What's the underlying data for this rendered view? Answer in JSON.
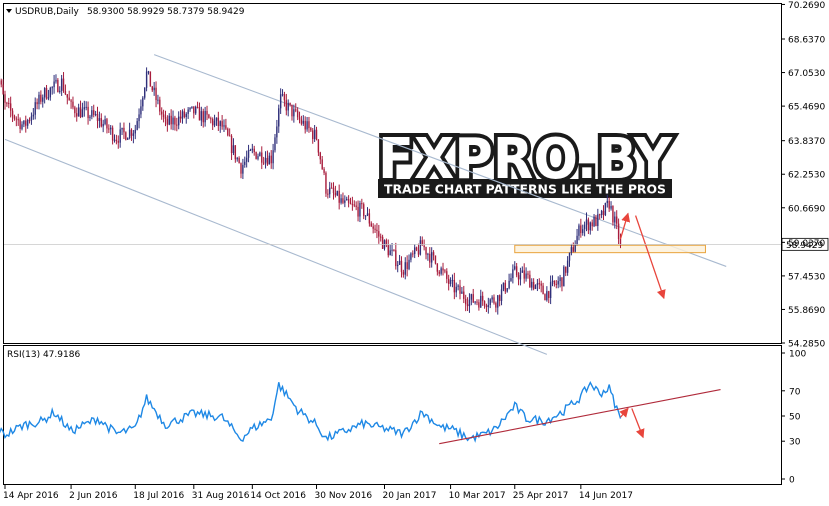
{
  "header": {
    "title": "USDRUB,Daily",
    "ohlc": "58.9300 58.9929 58.7379 58.9429"
  },
  "watermark": {
    "brand": "FXPRO.BY",
    "tagline": "TRADE CHART PATTERNS LIKE THE PROS"
  },
  "colors": {
    "bull": "#2f2f7a",
    "bear": "#a81c3c",
    "rsi": "#1e88e5",
    "channel": "#a8b9cf",
    "arrow": "#e8453c",
    "support_zone_stroke": "#e8a33c",
    "support_zone_fill": "#fdf0d8",
    "rsi_trendline": "#b02a3a"
  },
  "chart_data": [
    {
      "type": "candlestick",
      "symbol": "USDRUB",
      "timeframe": "Daily",
      "current_price_label": "58.9429",
      "current_price": 58.9429,
      "ylim": [
        54.285,
        70.29
      ],
      "y_tick_labels": [
        "70.2690",
        "68.6370",
        "67.0530",
        "65.4690",
        "63.8370",
        "62.2530",
        "60.6690",
        "59.0370",
        "57.4530",
        "55.8690",
        "54.2850"
      ],
      "x_tick_labels": [
        "14 Apr 2016",
        "2 Jun 2016",
        "18 Jul 2016",
        "31 Aug 2016",
        "14 Oct 2016",
        "30 Nov 2016",
        "20 Jan 2017",
        "10 Mar 2017",
        "25 Apr 2017",
        "14 Jun 2017"
      ],
      "x_tick_dates": [
        "2016-04-14",
        "2016-06-02",
        "2016-07-18",
        "2016-08-31",
        "2016-10-14",
        "2016-11-30",
        "2017-01-20",
        "2017-03-10",
        "2017-04-25",
        "2017-06-14"
      ],
      "approx_closes": [
        {
          "date": "2016-04-04",
          "close": 67.8
        },
        {
          "date": "2016-04-14",
          "close": 65.5
        },
        {
          "date": "2016-04-28",
          "close": 64.5
        },
        {
          "date": "2016-05-12",
          "close": 66.0
        },
        {
          "date": "2016-05-26",
          "close": 66.6
        },
        {
          "date": "2016-06-02",
          "close": 65.4
        },
        {
          "date": "2016-06-20",
          "close": 64.9
        },
        {
          "date": "2016-07-04",
          "close": 64.0
        },
        {
          "date": "2016-07-18",
          "close": 64.4
        },
        {
          "date": "2016-07-27",
          "close": 67.0
        },
        {
          "date": "2016-08-10",
          "close": 64.6
        },
        {
          "date": "2016-08-31",
          "close": 65.2
        },
        {
          "date": "2016-09-21",
          "close": 64.5
        },
        {
          "date": "2016-10-05",
          "close": 62.6
        },
        {
          "date": "2016-10-14",
          "close": 63.3
        },
        {
          "date": "2016-10-28",
          "close": 63.0
        },
        {
          "date": "2016-11-04",
          "close": 65.8
        },
        {
          "date": "2016-11-15",
          "close": 64.9
        },
        {
          "date": "2016-11-30",
          "close": 64.0
        },
        {
          "date": "2016-12-07",
          "close": 61.6
        },
        {
          "date": "2016-12-20",
          "close": 60.8
        },
        {
          "date": "2017-01-03",
          "close": 60.5
        },
        {
          "date": "2017-01-20",
          "close": 58.9
        },
        {
          "date": "2017-02-03",
          "close": 57.8
        },
        {
          "date": "2017-02-17",
          "close": 58.9
        },
        {
          "date": "2017-03-03",
          "close": 57.7
        },
        {
          "date": "2017-03-10",
          "close": 57.0
        },
        {
          "date": "2017-03-24",
          "close": 56.3
        },
        {
          "date": "2017-04-05",
          "close": 56.3
        },
        {
          "date": "2017-04-12",
          "close": 56.3
        },
        {
          "date": "2017-04-25",
          "close": 57.6
        },
        {
          "date": "2017-05-05",
          "close": 57.4
        },
        {
          "date": "2017-05-19",
          "close": 56.6
        },
        {
          "date": "2017-06-01",
          "close": 57.3
        },
        {
          "date": "2017-06-14",
          "close": 59.8
        },
        {
          "date": "2017-06-28",
          "close": 60.1
        },
        {
          "date": "2017-07-05",
          "close": 60.9
        },
        {
          "date": "2017-07-14",
          "close": 59.0
        }
      ],
      "support_zone": {
        "date_from": "2017-04-25",
        "date_to": "2017-09-15",
        "price_low": 58.55,
        "price_high": 58.9
      },
      "channel_lines": [
        {
          "role": "upper",
          "from": {
            "date": "2016-08-01",
            "price": 67.9
          },
          "to": {
            "date": "2017-09-30",
            "price": 57.9
          }
        },
        {
          "role": "lower",
          "from": {
            "date": "2016-04-14",
            "price": 63.9
          },
          "to": {
            "date": "2017-05-20",
            "price": 53.75
          }
        }
      ],
      "forecast_arrows": [
        {
          "from": {
            "date": "2017-07-14",
            "price": 59.2
          },
          "to": {
            "date": "2017-07-18",
            "price": 60.4
          }
        },
        {
          "from": {
            "date": "2017-07-24",
            "price": 60.3
          },
          "to": {
            "date": "2017-08-14",
            "price": 56.4
          }
        }
      ]
    },
    {
      "type": "line",
      "name": "RSI(13)",
      "label": "RSI(13) 47.9186",
      "current_value": 47.9186,
      "ylim": [
        0,
        100
      ],
      "y_ticks": [
        0,
        30,
        50,
        70,
        100
      ],
      "grid": false,
      "series": [
        {
          "date": "2016-04-04",
          "value": 42
        },
        {
          "date": "2016-04-14",
          "value": 35
        },
        {
          "date": "2016-04-28",
          "value": 43
        },
        {
          "date": "2016-05-12",
          "value": 46
        },
        {
          "date": "2016-05-20",
          "value": 53
        },
        {
          "date": "2016-06-02",
          "value": 38
        },
        {
          "date": "2016-06-20",
          "value": 48
        },
        {
          "date": "2016-07-04",
          "value": 36
        },
        {
          "date": "2016-07-18",
          "value": 40
        },
        {
          "date": "2016-07-27",
          "value": 64
        },
        {
          "date": "2016-08-10",
          "value": 43
        },
        {
          "date": "2016-08-31",
          "value": 52
        },
        {
          "date": "2016-09-21",
          "value": 49
        },
        {
          "date": "2016-10-05",
          "value": 32
        },
        {
          "date": "2016-10-14",
          "value": 40
        },
        {
          "date": "2016-10-28",
          "value": 48
        },
        {
          "date": "2016-11-02",
          "value": 75
        },
        {
          "date": "2016-11-15",
          "value": 55
        },
        {
          "date": "2016-11-30",
          "value": 43
        },
        {
          "date": "2016-12-07",
          "value": 32
        },
        {
          "date": "2016-12-20",
          "value": 38
        },
        {
          "date": "2017-01-03",
          "value": 44
        },
        {
          "date": "2017-01-20",
          "value": 40
        },
        {
          "date": "2017-02-03",
          "value": 36
        },
        {
          "date": "2017-02-17",
          "value": 53
        },
        {
          "date": "2017-03-03",
          "value": 41
        },
        {
          "date": "2017-03-10",
          "value": 40
        },
        {
          "date": "2017-03-24",
          "value": 32
        },
        {
          "date": "2017-04-05",
          "value": 36
        },
        {
          "date": "2017-04-12",
          "value": 40
        },
        {
          "date": "2017-04-25",
          "value": 58
        },
        {
          "date": "2017-05-05",
          "value": 48
        },
        {
          "date": "2017-05-19",
          "value": 46
        },
        {
          "date": "2017-06-01",
          "value": 53
        },
        {
          "date": "2017-06-14",
          "value": 65
        },
        {
          "date": "2017-06-20",
          "value": 76
        },
        {
          "date": "2017-06-28",
          "value": 68
        },
        {
          "date": "2017-07-05",
          "value": 72
        },
        {
          "date": "2017-07-14",
          "value": 48
        }
      ],
      "trendline": {
        "from": {
          "date": "2017-03-01",
          "value": 28
        },
        "to": {
          "date": "2017-09-25",
          "value": 71
        }
      },
      "forecast_arrows": [
        {
          "from": {
            "date": "2017-07-14",
            "value": 49
          },
          "to": {
            "date": "2017-07-20",
            "value": 56
          }
        },
        {
          "from": {
            "date": "2017-07-22",
            "value": 56
          },
          "to": {
            "date": "2017-07-30",
            "value": 33
          }
        }
      ]
    }
  ]
}
